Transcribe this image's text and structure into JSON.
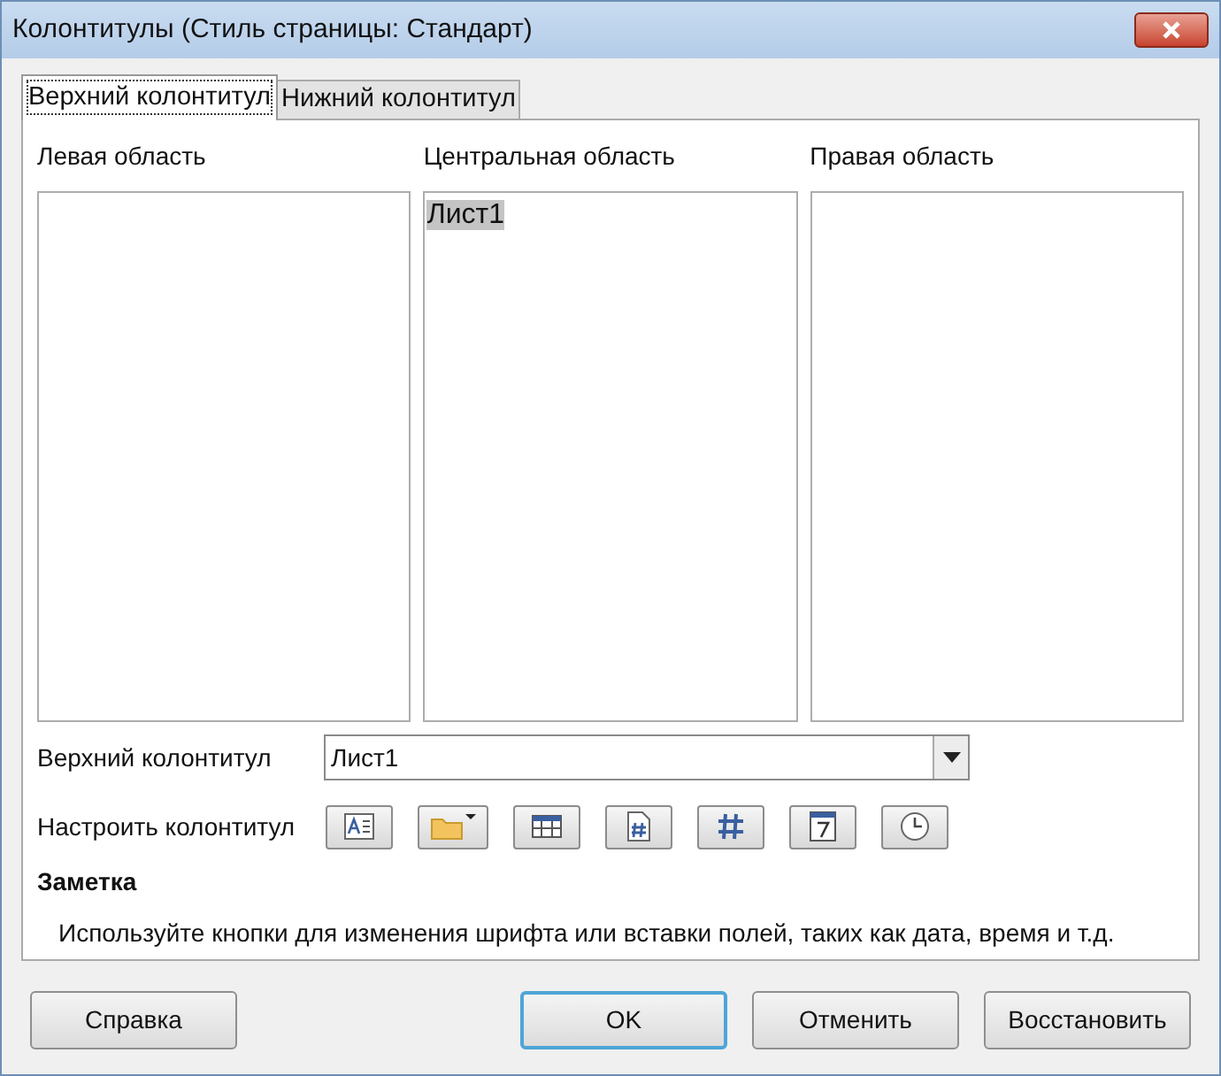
{
  "window": {
    "title": "Колонтитулы (Стиль страницы: Стандарт)"
  },
  "tabs": [
    {
      "label": "Верхний колонтитул",
      "selected": true
    },
    {
      "label": "Нижний колонтитул",
      "selected": false
    }
  ],
  "areas": [
    {
      "label": "Левая область"
    },
    {
      "label": "Центральная область",
      "text": "Лист1",
      "highlighted": true
    },
    {
      "label": "Правая область"
    }
  ],
  "header": {
    "label": "Верхний колонтитул",
    "value": "Лист1"
  },
  "customize": {
    "label": "Настроить колонтитул",
    "tools": [
      {
        "kind": "text"
      },
      {
        "kind": "folder"
      },
      {
        "kind": "table"
      },
      {
        "kind": "page"
      },
      {
        "kind": "hash"
      },
      {
        "kind": "date"
      },
      {
        "kind": "time"
      }
    ]
  },
  "note": {
    "title": "Заметка",
    "text": "Используйте кнопки для изменения шрифта или вставки полей, таких как дата, время и т.д."
  },
  "buttons": [
    {
      "label": "Справка",
      "default": false
    },
    {
      "label": "OK",
      "default": true
    },
    {
      "label": "Отменить",
      "default": false
    },
    {
      "label": "Восстановить",
      "default": false
    }
  ]
}
